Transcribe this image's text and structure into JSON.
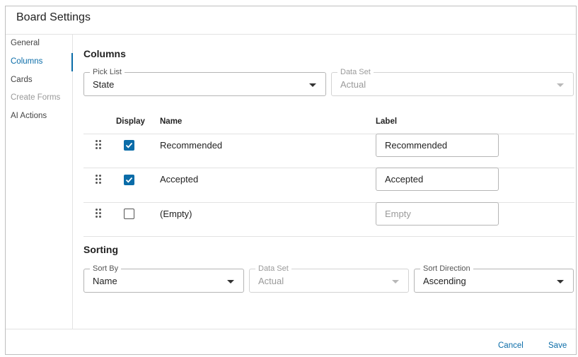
{
  "dialog": {
    "title": "Board Settings"
  },
  "sidebar": {
    "items": [
      {
        "label": "General"
      },
      {
        "label": "Columns"
      },
      {
        "label": "Cards"
      },
      {
        "label": "Create Forms"
      },
      {
        "label": "AI Actions"
      }
    ]
  },
  "columns": {
    "title": "Columns",
    "pick_list": {
      "label": "Pick List",
      "value": "State"
    },
    "data_set": {
      "label": "Data Set",
      "value": "Actual"
    },
    "headers": {
      "display": "Display",
      "name": "Name",
      "label": "Label"
    },
    "rows": [
      {
        "name": "Recommended",
        "checked": true,
        "label_value": "Recommended",
        "placeholder": ""
      },
      {
        "name": "Accepted",
        "checked": true,
        "label_value": "Accepted",
        "placeholder": ""
      },
      {
        "name": "(Empty)",
        "checked": false,
        "label_value": "",
        "placeholder": "Empty"
      }
    ]
  },
  "sorting": {
    "title": "Sorting",
    "sort_by": {
      "label": "Sort By",
      "value": "Name"
    },
    "data_set": {
      "label": "Data Set",
      "value": "Actual"
    },
    "sort_direction": {
      "label": "Sort Direction",
      "value": "Ascending"
    }
  },
  "footer": {
    "cancel_label": "Cancel",
    "save_label": "Save"
  },
  "colors": {
    "accent": "#0a6ca8",
    "border": "#b5b5b5",
    "disabled_text": "#9a9a9a"
  }
}
